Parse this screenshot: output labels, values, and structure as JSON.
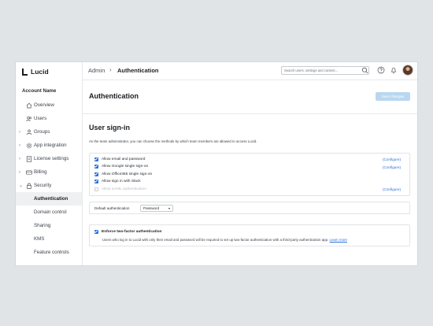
{
  "app": {
    "logo_text": "Lucid"
  },
  "sidebar": {
    "section_label": "Account Name",
    "items": [
      {
        "label": "Overview",
        "icon": "home-icon",
        "expandable": false
      },
      {
        "label": "Users",
        "icon": "users-icon",
        "expandable": false
      },
      {
        "label": "Groups",
        "icon": "group-icon",
        "expandable": true
      },
      {
        "label": "App integration",
        "icon": "gear-icon",
        "expandable": true
      },
      {
        "label": "License settings",
        "icon": "license-icon",
        "expandable": true
      },
      {
        "label": "Billing",
        "icon": "billing-icon",
        "expandable": true
      },
      {
        "label": "Security",
        "icon": "lock-icon",
        "expandable": true,
        "expanded": true
      }
    ],
    "sub_items": [
      {
        "label": "Authentication",
        "active": true
      },
      {
        "label": "Domain control"
      },
      {
        "label": "Sharing"
      },
      {
        "label": "KMS"
      },
      {
        "label": "Feature controls"
      }
    ]
  },
  "topbar": {
    "breadcrumb_root": "Admin",
    "breadcrumb_current": "Authentication",
    "search_placeholder": "Search users, settings and content..."
  },
  "header": {
    "title": "Authentication",
    "save_label": "Save changes"
  },
  "sign_in": {
    "title": "User sign-in",
    "description": "As the team administrator, you can choose the methods by which team members are allowed to access Lucid.",
    "methods": [
      {
        "label": "Allow email and password",
        "checked": true,
        "configure": "(Configure)"
      },
      {
        "label": "Allow Google single sign-on",
        "checked": true,
        "configure": "(Configure)"
      },
      {
        "label": "Allow Office365 single sign-on",
        "checked": true,
        "configure": ""
      },
      {
        "label": "Allow sign in with Slack",
        "checked": true,
        "configure": ""
      },
      {
        "label": "Allow SAML authentication",
        "checked": false,
        "disabled": true,
        "configure": "(Configure)"
      }
    ]
  },
  "default_auth": {
    "label": "Default authentication",
    "selected": "Password"
  },
  "two_factor": {
    "label": "Enforce two-factor authentication",
    "checked": true,
    "description": "Users who log in to Lucid with only their email and password will be required to set up two-factor authentication with a third-party authentication app.",
    "link_text": "Learn more"
  },
  "colors": {
    "accent": "#2a6fdb",
    "save_button_disabled": "#b9d7f0",
    "backdrop": "#e1e4e7"
  }
}
